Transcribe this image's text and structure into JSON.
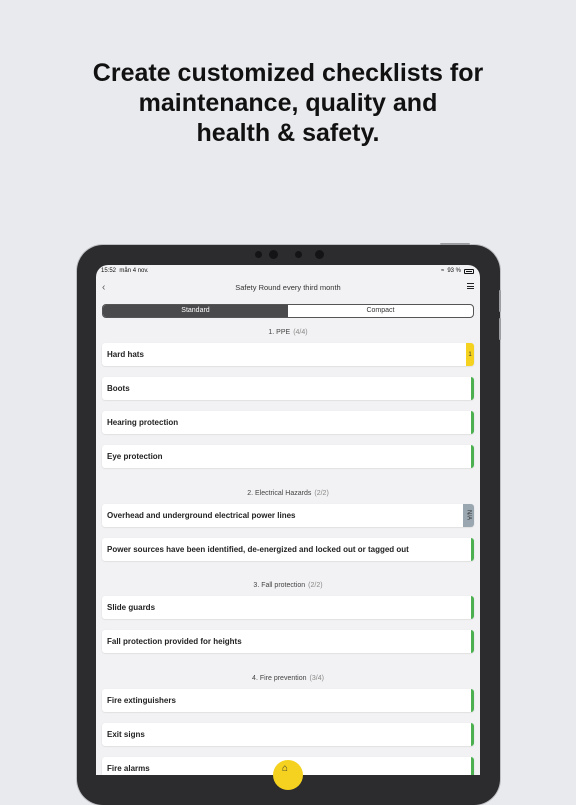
{
  "headline": {
    "line1": "Create customized checklists for",
    "line2": "maintenance, quality and",
    "line3": "health & safety."
  },
  "status_bar": {
    "time": "15:52",
    "date": "mån 4 nov.",
    "battery": "93 %"
  },
  "nav": {
    "back_icon": "chevron-left-icon",
    "title": "Safety Round every third month",
    "menu_icon": "menu-icon"
  },
  "segmented": {
    "standard": "Standard",
    "compact": "Compact",
    "selected": "Standard"
  },
  "sections": [
    {
      "title": "1. PPE",
      "count": "(4/4)",
      "items": [
        {
          "label": "Hard hats",
          "status": "yellow",
          "tag": "1"
        },
        {
          "label": "Boots",
          "status": "green"
        },
        {
          "label": "Hearing protection",
          "status": "green"
        },
        {
          "label": "Eye protection",
          "status": "green"
        }
      ]
    },
    {
      "title": "2. Electrical Hazards",
      "count": "(2/2)",
      "items": [
        {
          "label": "Overhead and underground electrical power lines",
          "status": "gray",
          "tag": "N/A"
        },
        {
          "label": "Power sources have been identified, de-energized and locked out or tagged out",
          "status": "green"
        }
      ]
    },
    {
      "title": "3. Fall protection",
      "count": "(2/2)",
      "items": [
        {
          "label": "Slide guards",
          "status": "green"
        },
        {
          "label": "Fall protection provided for heights",
          "status": "green"
        }
      ]
    },
    {
      "title": "4. Fire prevention",
      "count": "(3/4)",
      "items": [
        {
          "label": "Fire extinguishers",
          "status": "green"
        },
        {
          "label": "Exit signs",
          "status": "green"
        },
        {
          "label": "Fire alarms",
          "status": "green"
        }
      ]
    }
  ],
  "colors": {
    "green": "#4caf50",
    "yellow": "#f4d21f",
    "gray": "#9aa7b0"
  }
}
